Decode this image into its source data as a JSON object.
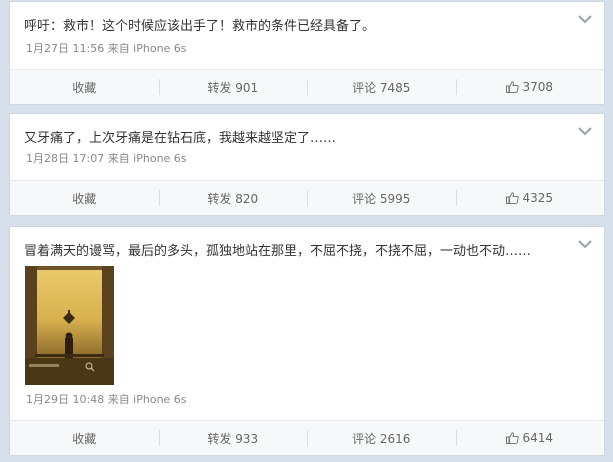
{
  "posts": [
    {
      "text": "呼吁：救市！这个时候应该出手了！救市的条件已经具备了。",
      "meta": "1月27日 11:56 来自 iPhone 6s",
      "actions": {
        "favorite": "收藏",
        "repost": "转发 901",
        "comment": "评论 7485",
        "like": "3708"
      }
    },
    {
      "text": "又牙痛了，上次牙痛是在钻石底，我越来越坚定了……",
      "meta": "1月28日 17:07 来自 iPhone 6s",
      "actions": {
        "favorite": "收藏",
        "repost": "转发 820",
        "comment": "评论 5995",
        "like": "4325"
      }
    },
    {
      "text": "冒着满天的谩骂，最后的多头，孤独地站在那里，不屈不挠，不挠不屈，一动也不动……",
      "meta": "1月29日 10:48 来自 iPhone 6s",
      "actions": {
        "favorite": "收藏",
        "repost": "转发 933",
        "comment": "评论 2616",
        "like": "6414"
      }
    }
  ],
  "icons": {
    "menu": "chevron-down-icon",
    "like": "thumbs-up-icon"
  },
  "colors": {
    "page_background": "#d7e0ea",
    "card_background": "#ffffff",
    "meta_text": "#888888",
    "action_bar": "#f7f8fa"
  }
}
